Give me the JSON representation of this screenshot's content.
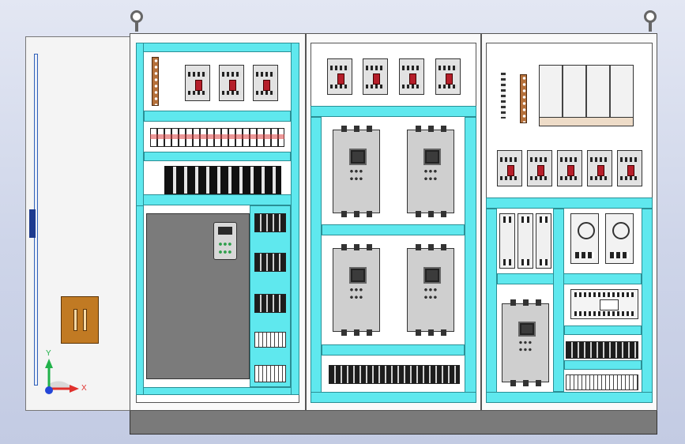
{
  "view": {
    "type": "cad-assembly-front-view",
    "background_gradient": [
      "#e3e7f3",
      "#c3cbe3"
    ]
  },
  "triad": {
    "x_label": "X",
    "y_label": "Y",
    "x_color": "#e0302c",
    "y_color": "#21b24a",
    "z_color": "#2346d8"
  },
  "colors": {
    "mounting_plate": "#5fe8ee",
    "panel_frame": "#fafafa",
    "enclosure_base": "#7a7a7a",
    "breaker_handle": "#b51e2a",
    "busbar": "#b5703a",
    "handle": "#c17a23"
  },
  "icons": {
    "lifting_eye": "lifting-eye-icon",
    "breaker": "circuit-breaker-icon",
    "vfd": "variable-frequency-drive-icon",
    "terminal": "terminal-block-icon",
    "power_supply": "power-supply-icon"
  }
}
